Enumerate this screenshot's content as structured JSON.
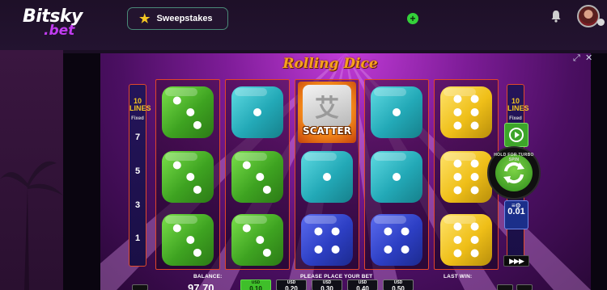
{
  "site": {
    "logo_main": "Bitsky",
    "logo_sub": ".bet",
    "sweepstakes_label": "Sweepstakes",
    "plus_symbol": "+"
  },
  "game": {
    "title": "Rolling Dice",
    "scatter_symbol": "艾",
    "scatter_label": "SCATTER",
    "reels": [
      [
        "green",
        "green",
        "green"
      ],
      [
        "teal",
        "green",
        "green"
      ],
      [
        "scatter",
        "teal",
        "blue"
      ],
      [
        "teal",
        "teal",
        "blue"
      ],
      [
        "yellow",
        "yellow",
        "yellow"
      ]
    ],
    "die_faces": [
      [
        3,
        3,
        3
      ],
      [
        1,
        3,
        3
      ],
      [
        0,
        1,
        4
      ],
      [
        1,
        1,
        4
      ],
      [
        6,
        6,
        6
      ]
    ],
    "colors": {
      "green": "#4cc92c",
      "teal": "#2ab7c4",
      "blue": "#2d3fc4",
      "yellow": "#f0c21a",
      "reel_border": "#e0452a",
      "title": "#f7a21b"
    },
    "lines_left": {
      "count": "10",
      "label": "LINES",
      "fixed": "Fixed",
      "numbers": [
        "7",
        "5",
        "3",
        "1"
      ]
    },
    "lines_right": {
      "count": "10",
      "label": "LINES",
      "fixed": "Fixed"
    },
    "turbo_text": "HOLD FOR TURBO SPIN",
    "bet_value": "0.01",
    "fast_forward_label": "▶▶▶"
  },
  "footer": {
    "balance_label": "BALANCE:",
    "balance_value": "97.70",
    "place_bet_label": "PLEASE PLACE YOUR BET",
    "last_win_label": "LAST WIN:",
    "chip_currency": "USD",
    "chips": [
      {
        "currency": "USD",
        "value": "0.10",
        "active": true
      },
      {
        "currency": "USD",
        "value": "0.20",
        "active": false
      },
      {
        "currency": "USD",
        "value": "0.30",
        "active": false
      },
      {
        "currency": "USD",
        "value": "0.40",
        "active": false
      },
      {
        "currency": "USD",
        "value": "0.50",
        "active": false
      }
    ]
  }
}
